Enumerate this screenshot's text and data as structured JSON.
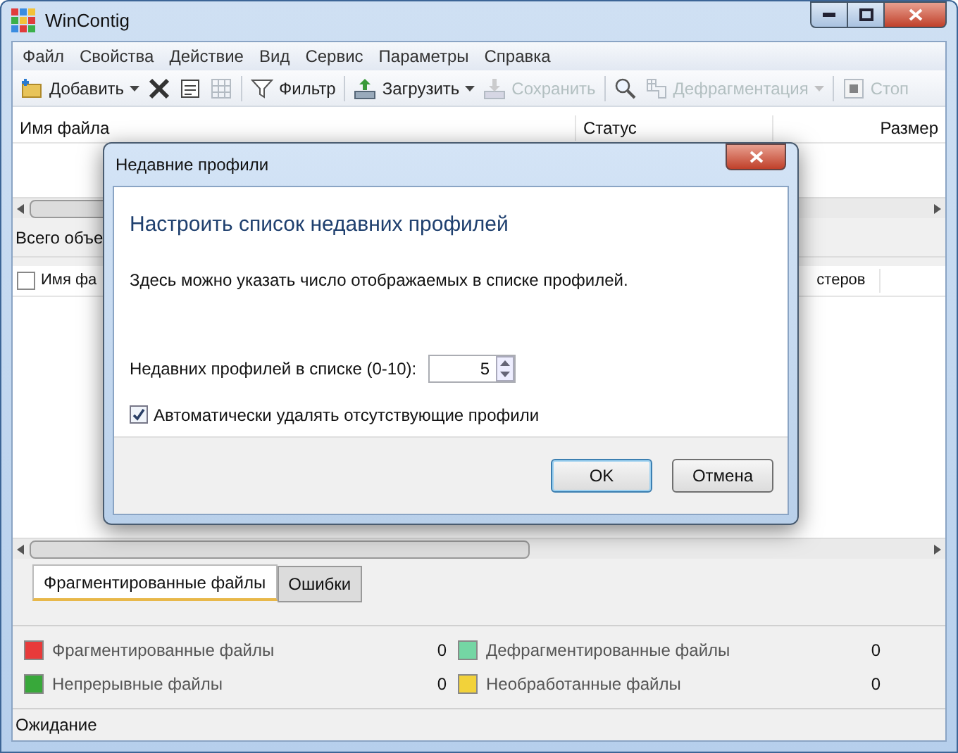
{
  "window": {
    "title": "WinContig"
  },
  "menu": [
    "Файл",
    "Свойства",
    "Действие",
    "Вид",
    "Сервис",
    "Параметры",
    "Справка"
  ],
  "toolbar": [
    {
      "kind": "add",
      "label": "Добавить",
      "dropdown": true,
      "disabled": false
    },
    {
      "kind": "delete",
      "disabled": false
    },
    {
      "kind": "properties",
      "disabled": false
    },
    {
      "kind": "grid",
      "disabled": true
    },
    {
      "kind": "separator"
    },
    {
      "kind": "filter",
      "label": "Фильтр",
      "dropdown": false,
      "disabled": false
    },
    {
      "kind": "separator"
    },
    {
      "kind": "load",
      "label": "Загрузить",
      "dropdown": true,
      "disabled": false
    },
    {
      "kind": "save",
      "label": "Сохранить",
      "dropdown": false,
      "disabled": true
    },
    {
      "kind": "separator"
    },
    {
      "kind": "search",
      "disabled": false
    },
    {
      "kind": "defrag",
      "label": "Дефрагментация",
      "dropdown": true,
      "disabled": true
    },
    {
      "kind": "separator"
    },
    {
      "kind": "stop",
      "label": "Стоп",
      "dropdown": false,
      "disabled": true
    }
  ],
  "files_table": {
    "columns": [
      "Имя файла",
      "Статус",
      "Размер"
    ]
  },
  "summary": "Всего объе",
  "clusters_table": {
    "columns": [
      "Имя фа",
      "стеров"
    ],
    "select_all_checked": false
  },
  "tabs": [
    {
      "label": "Фрагментированные файлы",
      "selected": true
    },
    {
      "label": "Ошибки",
      "selected": false
    }
  ],
  "legend": [
    {
      "label": "Фрагментированные файлы",
      "count": "0",
      "color": "#e83a3a"
    },
    {
      "label": "Дефрагментированные файлы",
      "count": "0",
      "color": "#74d6a4"
    },
    {
      "label": "Непрерывные файлы",
      "count": "0",
      "color": "#38a83a"
    },
    {
      "label": "Необработанные файлы",
      "count": "0",
      "color": "#f2d23a"
    }
  ],
  "status_bar": "Ожидание",
  "dialog": {
    "title": "Недавние профили",
    "heading": "Настроить список недавних профилей",
    "description": "Здесь можно указать число отображаемых в списке профилей.",
    "count_label": "Недавних профилей в списке (0-10):",
    "count_value": "5",
    "auto_remove": {
      "label": "Автоматически удалять отсутствующие профили",
      "checked": true
    },
    "buttons": [
      {
        "label": "OK",
        "default": true
      },
      {
        "label": "Отмена",
        "default": false
      }
    ]
  }
}
